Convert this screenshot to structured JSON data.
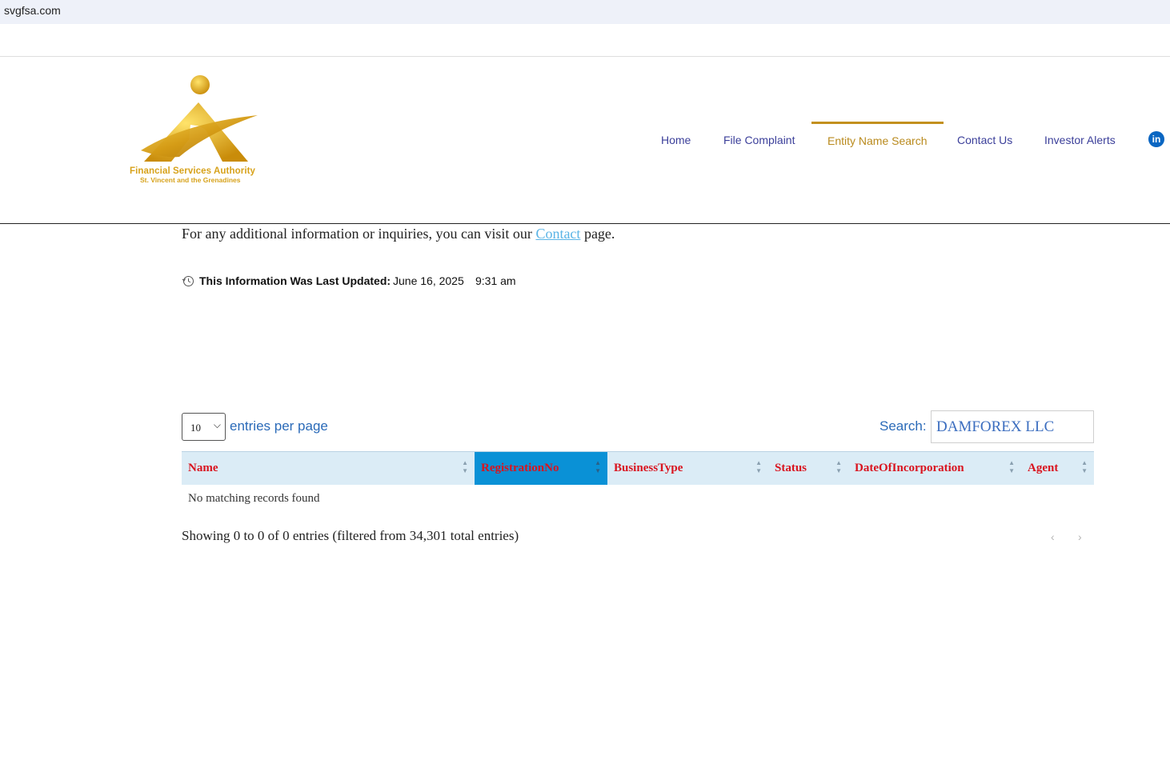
{
  "browser": {
    "domain": "svgfsa.com"
  },
  "logo": {
    "line1": "Financial Services Authority",
    "line2": "St. Vincent and the Grenadines"
  },
  "nav": {
    "items": [
      {
        "label": "Home"
      },
      {
        "label": "File Complaint"
      },
      {
        "label": "Entity Name Search",
        "active": true
      },
      {
        "label": "Contact Us"
      },
      {
        "label": "Investor Alerts"
      }
    ],
    "social_icon": "linkedin-icon"
  },
  "info": {
    "prefix": "For any additional information or inquiries, you can visit our ",
    "link": "Contact",
    "suffix": " page."
  },
  "updated": {
    "label": "This Information Was Last Updated:",
    "date": "June 16, 2025",
    "time": "9:31 am",
    "icon": "history-icon"
  },
  "table_controls": {
    "entries_value": "10",
    "entries_label": "entries per page",
    "search_label": "Search:",
    "search_value": "DAMFOREX LLC"
  },
  "table": {
    "columns": [
      "Name",
      "RegistrationNo",
      "BusinessType",
      "Status",
      "DateOfIncorporation",
      "Agent"
    ],
    "sorted_column": "RegistrationNo",
    "empty_message": "No matching records found"
  },
  "footer": {
    "showing": "Showing 0 to 0 of 0 entries (filtered from 34,301 total entries)",
    "prev": "‹",
    "next": "›"
  },
  "colors": {
    "brand_gold": "#d7a21b",
    "nav_blue": "#3b3f9a",
    "header_red": "#d9141f",
    "active_header": "#0a91d6",
    "table_head_bg": "#dbecf6"
  }
}
